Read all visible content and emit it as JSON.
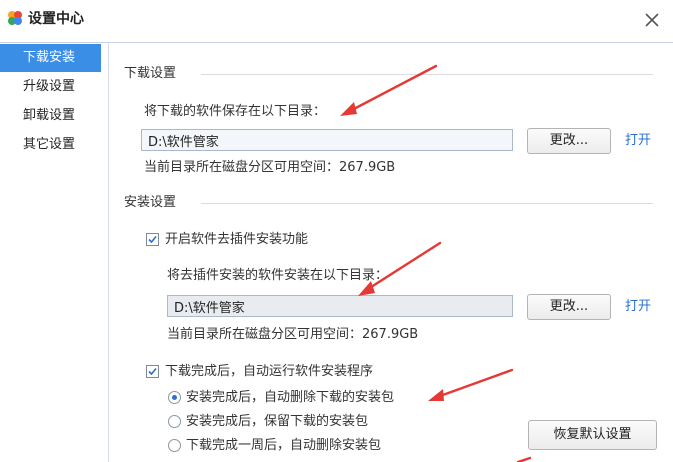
{
  "window": {
    "title": "设置中心",
    "close_icon": "close-icon",
    "app_icon": "clover-logo-icon"
  },
  "sidebar": {
    "items": [
      {
        "label": "下载安装",
        "active": true
      },
      {
        "label": "升级设置",
        "active": false
      },
      {
        "label": "卸载设置",
        "active": false
      },
      {
        "label": "其它设置",
        "active": false
      }
    ]
  },
  "download": {
    "section_title": "下载设置",
    "save_label": "将下载的软件保存在以下目录：",
    "path": "D:\\软件管家",
    "change_label": "更改...",
    "open_label": "打开",
    "space_label": "当前目录所在磁盘分区可用空间：267.9GB"
  },
  "install": {
    "section_title": "安装设置",
    "plugin_removal_label": "开启软件去插件安装功能",
    "plugin_removal_checked": true,
    "install_dir_label": "将去插件安装的软件安装在以下目录：",
    "path": "D:\\软件管家",
    "change_label": "更改...",
    "open_label": "打开",
    "space_label": "当前目录所在磁盘分区可用空间：267.9GB",
    "auto_run_label": "下载完成后，自动运行软件安装程序",
    "auto_run_checked": true,
    "options": [
      {
        "label": "安装完成后，自动删除下载的安装包",
        "checked": true
      },
      {
        "label": "安装完成后，保留下载的安装包",
        "checked": false
      },
      {
        "label": "下载完成一周后，自动删除安装包",
        "checked": false
      }
    ],
    "restore_label": "恢复默认设置"
  },
  "colors": {
    "accent": "#3a8ee6",
    "link": "#2a6fd6",
    "annotation_arrow": "#e53935"
  }
}
